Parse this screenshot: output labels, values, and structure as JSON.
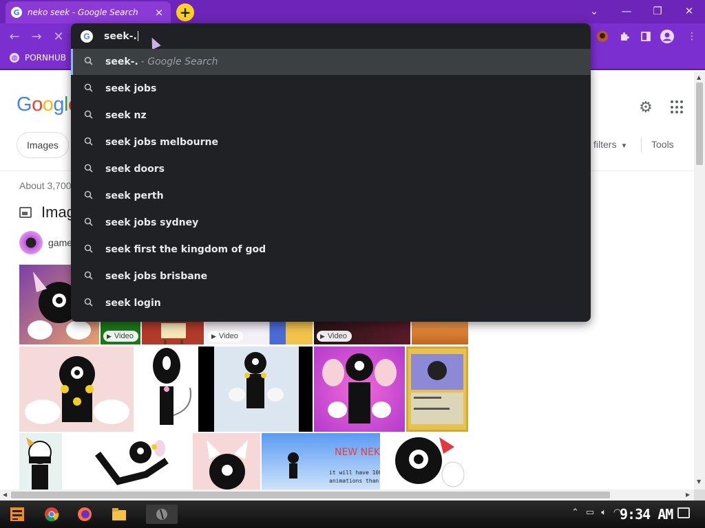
{
  "browser": {
    "tab_title": "neko seek - Google Search",
    "tab_favicon": "G",
    "new_tab_label": "+",
    "window_controls": {
      "chevron": "⌄",
      "minimize": "—",
      "restore": "❐",
      "close": "✕"
    },
    "nav": {
      "back": "←",
      "forward": "→",
      "reload": "✕"
    },
    "bookmark": {
      "label": "PORNHUB"
    },
    "accent_color": "#7c2fcf",
    "tab_color": "#8b3ad6"
  },
  "omnibox": {
    "typed_text": "seek-.",
    "suggestions": [
      {
        "text": "seek-.",
        "suffix": "- Google Search",
        "selected": true
      },
      {
        "text": "seek jobs"
      },
      {
        "text": "seek nz"
      },
      {
        "text": "seek jobs melbourne"
      },
      {
        "text": "seek doors"
      },
      {
        "text": "seek perth"
      },
      {
        "text": "seek jobs sydney"
      },
      {
        "text": "seek first the kingdom of god"
      },
      {
        "text": "seek jobs brisbane"
      },
      {
        "text": "seek login"
      }
    ]
  },
  "page": {
    "logo_text": "Google",
    "chip_images": "Images",
    "all_filters": "filters",
    "tools": "Tools",
    "result_count": "About 3,700",
    "images_heading": "Imag",
    "games_chip": "game",
    "video_badge": "Video"
  },
  "taskbar": {
    "clock": "9:34 AM"
  }
}
